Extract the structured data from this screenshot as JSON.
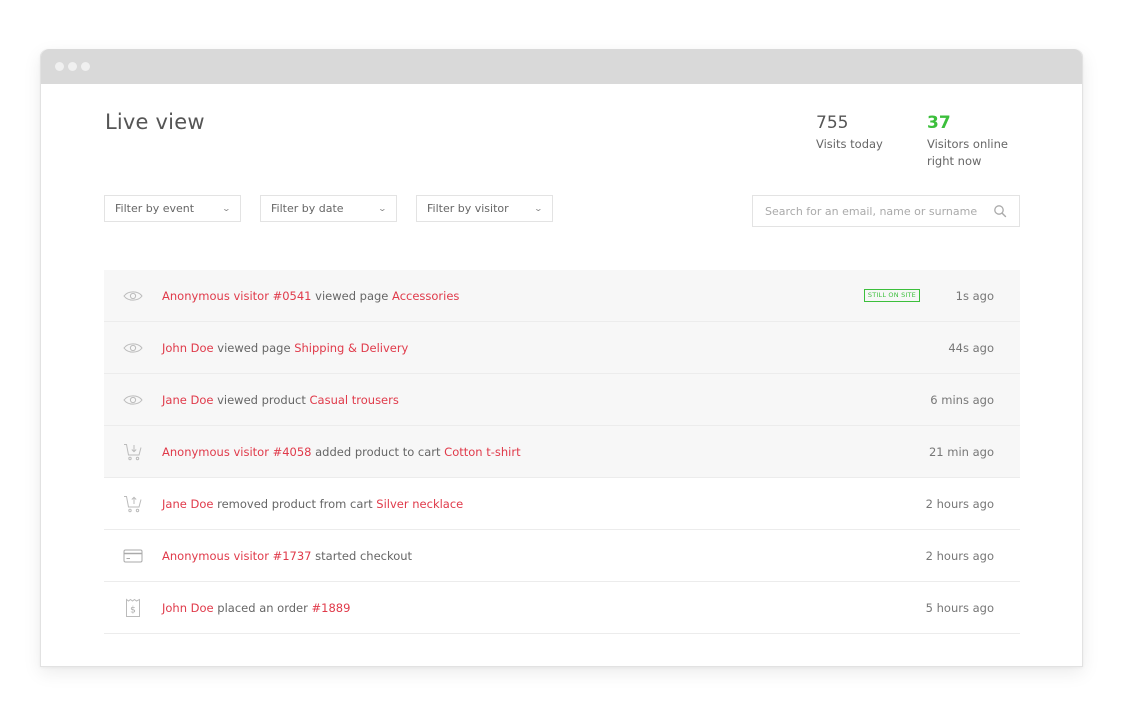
{
  "window": {
    "controls": [
      "close",
      "minimize",
      "maximize"
    ]
  },
  "header": {
    "title": "Live view"
  },
  "stats": {
    "visits": {
      "value": "755",
      "label": "Visits today"
    },
    "online": {
      "value": "37",
      "label_line1": "Visitors online",
      "label_line2": "right now",
      "color": "#3cbf3c"
    }
  },
  "filters": [
    {
      "label": "Filter by event",
      "icon": "chevron-down-icon"
    },
    {
      "label": "Filter by date",
      "icon": "chevron-down-icon"
    },
    {
      "label": "Filter by visitor",
      "icon": "chevron-down-icon"
    }
  ],
  "search": {
    "placeholder": "Search for an email, name or surname",
    "value": "",
    "icon": "search-icon"
  },
  "colors": {
    "highlight": "#e03a4a",
    "online_green": "#3cbf3c",
    "row_shade": "#f7f7f7"
  },
  "feed": [
    {
      "icon": "eye-icon",
      "actor": "Anonymous visitor #0541",
      "action": " viewed page ",
      "target": "Accessories",
      "badge": "STILL ON SITE",
      "time": "1s ago"
    },
    {
      "icon": "eye-icon",
      "actor": "John Doe",
      "action": " viewed page ",
      "target": "Shipping & Delivery",
      "time": "44s ago"
    },
    {
      "icon": "eye-icon",
      "actor": "Jane Doe",
      "action": " viewed product ",
      "target": "Casual trousers",
      "time": "6 mins ago"
    },
    {
      "icon": "cart-add-icon",
      "actor": "Anonymous visitor #4058",
      "action": " added product to cart ",
      "target": "Cotton t-shirt",
      "time": "21 min ago"
    },
    {
      "icon": "cart-remove-icon",
      "actor": "Jane Doe",
      "action": " removed product from cart ",
      "target": "Silver necklace",
      "time": "2 hours ago"
    },
    {
      "icon": "credit-card-icon",
      "actor": "Anonymous visitor #1737",
      "action": " started checkout",
      "target": "",
      "time": "2 hours ago"
    },
    {
      "icon": "receipt-icon",
      "actor": "John Doe",
      "action": " placed an order ",
      "target": "#1889",
      "time": "5 hours ago"
    }
  ]
}
